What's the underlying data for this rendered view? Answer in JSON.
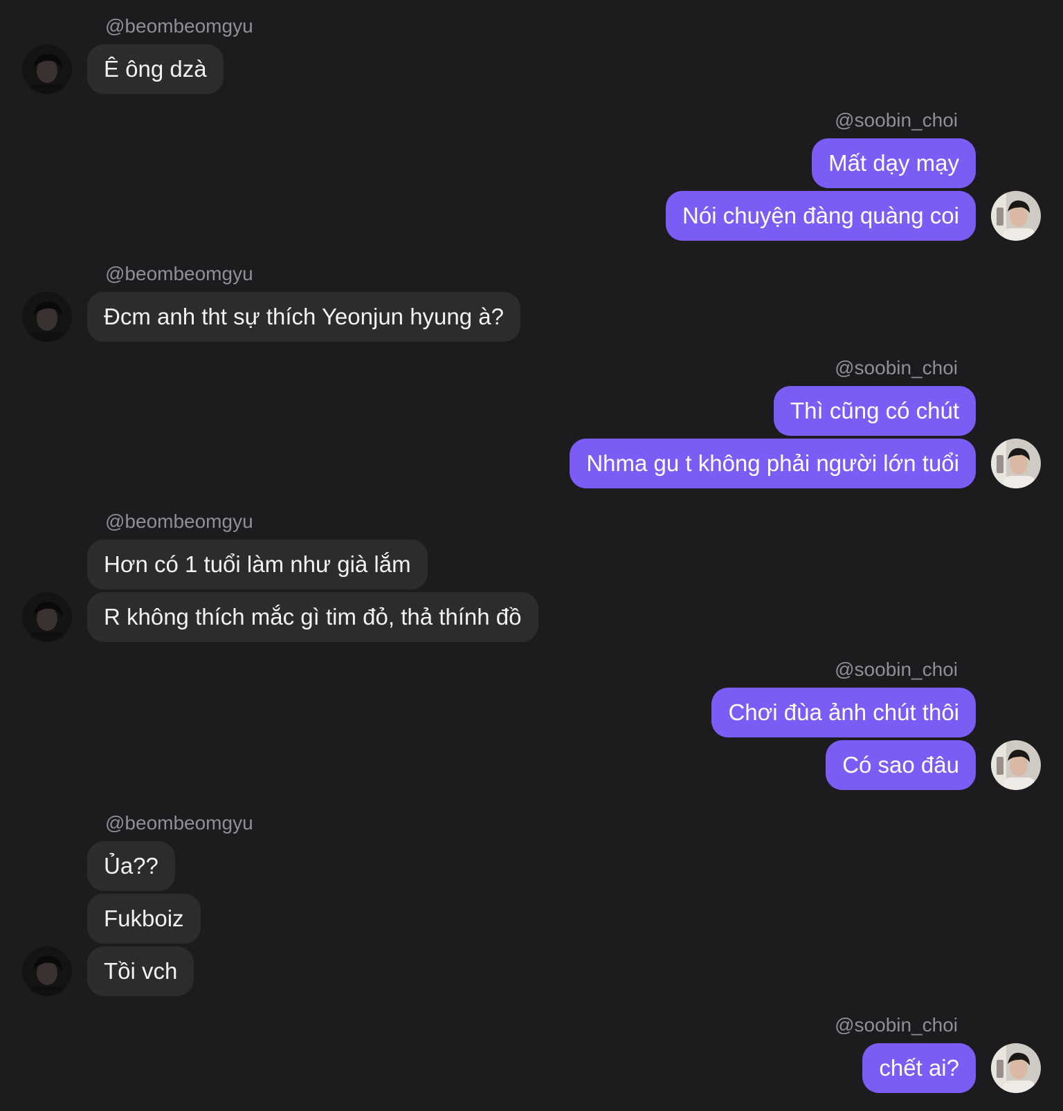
{
  "colors": {
    "background": "#1c1c1e",
    "incoming_bubble": "#2c2c2e",
    "outgoing_bubble": "#7b5cf5",
    "handle_text": "#8f8f95"
  },
  "participants": {
    "incoming": {
      "handle": "@beombeomgyu",
      "avatar_icon": "user-avatar-dark-icon"
    },
    "outgoing": {
      "handle": "@soobin_choi",
      "avatar_icon": "user-avatar-light-icon"
    }
  },
  "messages": [
    {
      "handle": "@beombeomgyu",
      "bubbles": [
        "Ê ông dzà"
      ]
    },
    {
      "handle": "@soobin_choi",
      "bubbles": [
        "Mất dạy mạy",
        "Nói chuyện đàng quàng coi"
      ]
    },
    {
      "handle": "@beombeomgyu",
      "bubbles": [
        "Đcm anh tht sự thích Yeonjun hyung à?"
      ]
    },
    {
      "handle": "@soobin_choi",
      "bubbles": [
        "Thì cũng có chút",
        "Nhma gu t không phải người lớn tuổi"
      ]
    },
    {
      "handle": "@beombeomgyu",
      "bubbles": [
        "Hơn có 1 tuổi làm như già lắm",
        "R không thích mắc gì tim đỏ, thả thính đồ"
      ]
    },
    {
      "handle": "@soobin_choi",
      "bubbles": [
        "Chơi đùa ảnh chút thôi",
        "Có sao đâu"
      ]
    },
    {
      "handle": "@beombeomgyu",
      "bubbles": [
        "Ủa??",
        "Fukboiz",
        "Tồi vch"
      ]
    },
    {
      "handle": "@soobin_choi",
      "bubbles": [
        "chết ai?"
      ]
    }
  ]
}
